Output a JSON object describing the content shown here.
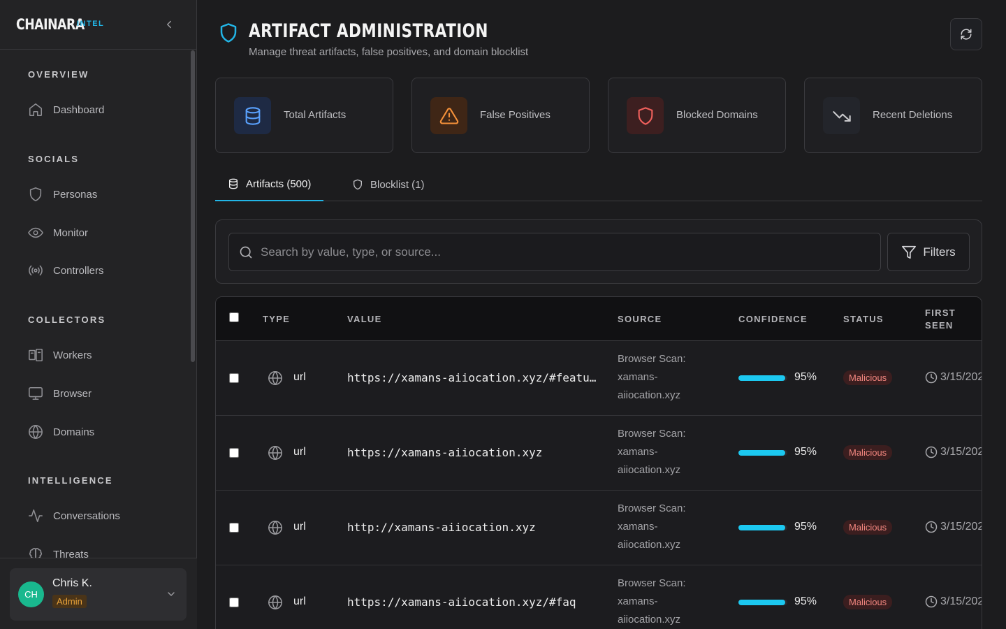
{
  "sidebar": {
    "brand": "CHAINARA",
    "brand_tag": "INTEL",
    "sections": [
      {
        "title": "OVERVIEW",
        "items": [
          {
            "label": "Dashboard",
            "icon": "home-icon"
          }
        ]
      },
      {
        "title": "SOCIALS",
        "items": [
          {
            "label": "Personas",
            "icon": "shield-icon"
          },
          {
            "label": "Monitor",
            "icon": "eye-icon"
          },
          {
            "label": "Controllers",
            "icon": "radio-icon"
          }
        ]
      },
      {
        "title": "COLLECTORS",
        "items": [
          {
            "label": "Workers",
            "icon": "workers-icon"
          },
          {
            "label": "Browser",
            "icon": "monitor-icon"
          },
          {
            "label": "Domains",
            "icon": "globe-icon"
          }
        ]
      },
      {
        "title": "INTELLIGENCE",
        "items": [
          {
            "label": "Conversations",
            "icon": "activity-icon"
          },
          {
            "label": "Threats",
            "icon": "brain-icon"
          }
        ]
      }
    ],
    "user": {
      "initials": "CH",
      "name": "Chris K.",
      "role": "Admin"
    }
  },
  "header": {
    "title": "ARTIFACT ADMINISTRATION",
    "subtitle": "Manage threat artifacts, false positives, and domain blocklist"
  },
  "stats": [
    {
      "label": "Total Artifacts",
      "icon": "database-icon",
      "color": "#5aa2ff",
      "bg": "#1e2a44"
    },
    {
      "label": "False Positives",
      "icon": "warning-icon",
      "color": "#f5913a",
      "bg": "#3f2616"
    },
    {
      "label": "Blocked Domains",
      "icon": "shield-icon",
      "color": "#f0605c",
      "bg": "#3d1f20"
    },
    {
      "label": "Recent Deletions",
      "icon": "trending-down-icon",
      "color": "#c9c9cc",
      "bg": "#23252b"
    }
  ],
  "tabs": [
    {
      "label": "Artifacts (500)",
      "active": true
    },
    {
      "label": "Blocklist (1)",
      "active": false
    }
  ],
  "search": {
    "placeholder": "Search by value, type, or source...",
    "value": ""
  },
  "filters_label": "Filters",
  "table": {
    "headers": {
      "type": "TYPE",
      "value": "VALUE",
      "source": "SOURCE",
      "confidence": "CONFIDENCE",
      "status": "STATUS",
      "first_seen_1": "FIRST",
      "first_seen_2": "SEEN"
    },
    "rows": [
      {
        "type": "url",
        "value": "https://xamans-aiiocation.xyz/#features",
        "source_1": "Browser Scan:",
        "source_2": "xamans-",
        "source_3": "aiiocation.xyz",
        "confidence": "95%",
        "confidence_value": 0.95,
        "status": "Malicious",
        "first_seen": "3/15/202"
      },
      {
        "type": "url",
        "value": "https://xamans-aiiocation.xyz",
        "source_1": "Browser Scan:",
        "source_2": "xamans-",
        "source_3": "aiiocation.xyz",
        "confidence": "95%",
        "confidence_value": 0.95,
        "status": "Malicious",
        "first_seen": "3/15/202"
      },
      {
        "type": "url",
        "value": "http://xamans-aiiocation.xyz",
        "source_1": "Browser Scan:",
        "source_2": "xamans-",
        "source_3": "aiiocation.xyz",
        "confidence": "95%",
        "confidence_value": 0.95,
        "status": "Malicious",
        "first_seen": "3/15/202"
      },
      {
        "type": "url",
        "value": "https://xamans-aiiocation.xyz/#faq",
        "source_1": "Browser Scan:",
        "source_2": "xamans-",
        "source_3": "aiiocation.xyz",
        "confidence": "95%",
        "confidence_value": 0.95,
        "status": "Malicious",
        "first_seen": "3/15/202"
      }
    ]
  }
}
